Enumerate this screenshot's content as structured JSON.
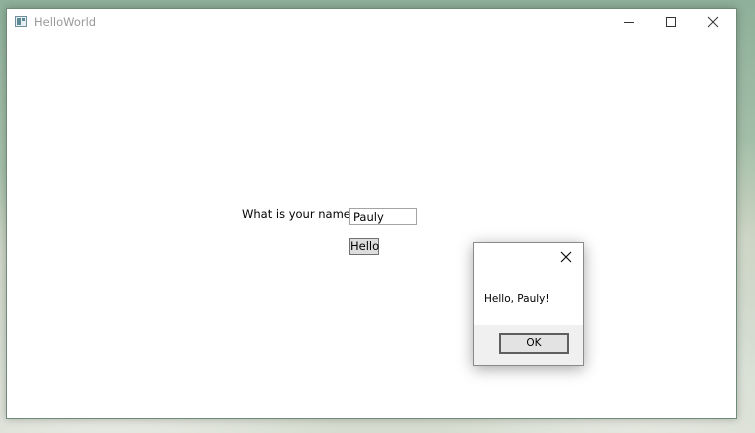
{
  "window": {
    "title": "HelloWorld",
    "icon": "app-window-icon",
    "controls": [
      "minimize-icon",
      "maximize-icon",
      "close-icon"
    ]
  },
  "form": {
    "name_label": "What is your name?",
    "name_value": "Pauly",
    "hello_button_label": "Hello"
  },
  "dialog": {
    "message": "Hello, Pauly!",
    "ok_label": "OK",
    "close_icon": "close-icon"
  },
  "colors": {
    "window_background": "#ffffff",
    "title_text": "#999999",
    "dialog_footer": "#f0f0f0",
    "button_face": "#dddddd",
    "desktop_tint": "#a4bfa9"
  }
}
